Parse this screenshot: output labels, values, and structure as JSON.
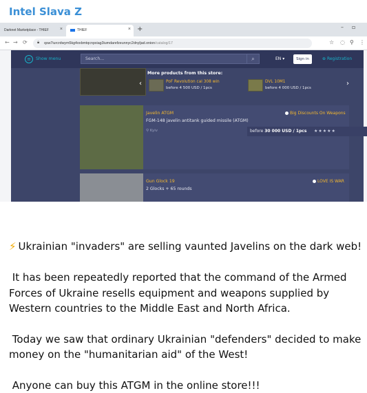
{
  "channel": {
    "title": "Intel Slava Z"
  },
  "browser": {
    "tabs": [
      {
        "label": "Darknet Marketplace - THIEF"
      },
      {
        "label": "THIEF"
      }
    ],
    "url": {
      "host": "qsw7iurcrdwym5kg4oxbmtqcnpxiag3iumdarefzeunnyc2dnyljad.onion",
      "path": "/catalog/17"
    }
  },
  "store": {
    "nav": {
      "show_menu": "Show menu",
      "search_placeholder": "Search...",
      "lang": "EN",
      "sign_in": "Sign in",
      "registration": "Registration"
    },
    "more_products": {
      "title": "More products from this store:",
      "items": [
        {
          "title": "PoF Revolution cal 308 win",
          "price": "before 4 500 USD / 1pcs"
        },
        {
          "title": "DVL 10M1",
          "price": "before 4 000 USD / 1pcs"
        }
      ]
    },
    "products": [
      {
        "title": "Javelin ATGM",
        "desc": "FGM-148 javelin antitank guided missile (ATGM)",
        "location": "Kyiv",
        "badge": "Big Discounts On Weapons",
        "price_prefix": "before",
        "price": "30 000 USD / 1pcs",
        "stars": "★★★★★"
      },
      {
        "title": "Gun Glock 19",
        "desc": "2 Glocks + 65 rounds",
        "badge": "LOVE IS WAR"
      }
    ]
  },
  "post": {
    "p1": "Ukrainian \"invaders\" are selling vaunted Javelins on the dark web!",
    "p2": "It has been repeatedly reported that the command of the Armed Forces of Ukraine resells equipment and weapons supplied by Western countries to the Middle East and North Africa.",
    "p3": "Today we saw that ordinary Ukrainian \"defenders\" decided to make money on the \"humanitarian aid\" of the West!",
    "p4": "Anyone can buy this ATGM in the online store!!!"
  },
  "colors": {
    "channel_title": "#3a8fd6",
    "store_bg": "#3d4569",
    "accent_cyan": "#17b3c9",
    "accent_gold": "#f5b82e"
  },
  "icons": [
    "flag-ukraine-icon",
    "lightning-icon",
    "hamburger-menu-icon",
    "search-icon",
    "lock-icon",
    "star-icon",
    "location-pin-icon"
  ]
}
